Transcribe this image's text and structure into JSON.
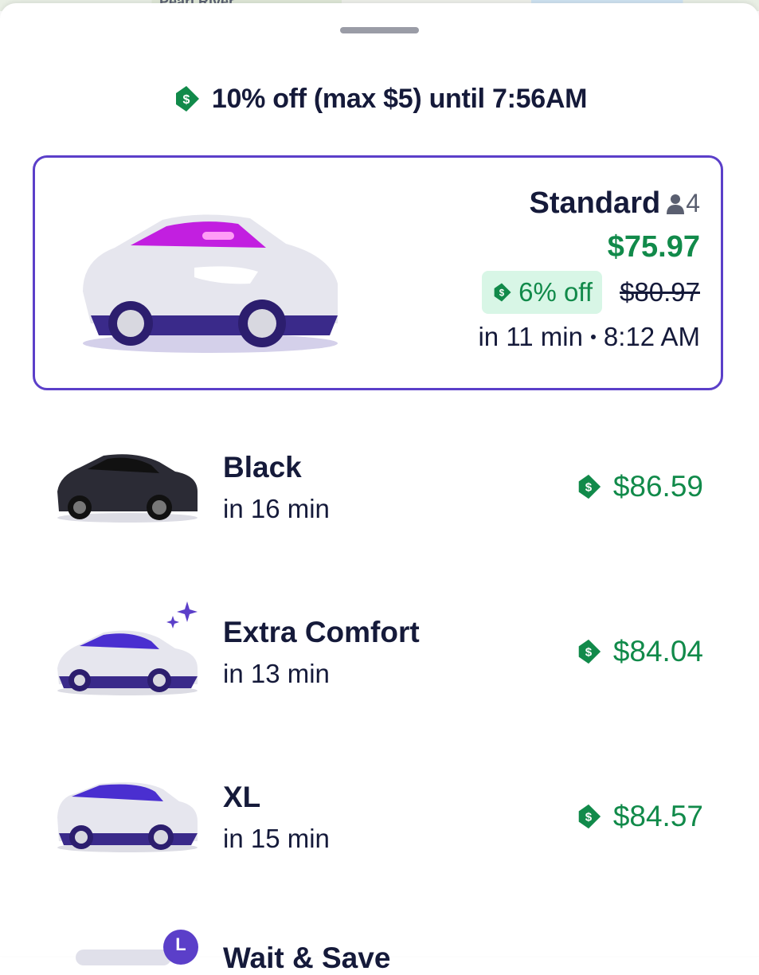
{
  "map": {
    "label": "Pearl River"
  },
  "promo": {
    "text": "10% off (max $5) until 7:56AM",
    "icon": "discount-tag-icon"
  },
  "colors": {
    "accent": "#5b3fc9",
    "price_green": "#118a4a",
    "badge_bg": "#d8f6e6",
    "text": "#151a3a"
  },
  "standard": {
    "title": "Standard",
    "seats": "4",
    "price": "$75.97",
    "discount": "6% off",
    "original_price": "$80.97",
    "eta": "in 11 min",
    "arrival": "8:12 AM"
  },
  "options": [
    {
      "title": "Black",
      "eta": "in 16 min",
      "price": "$86.59"
    },
    {
      "title": "Extra Comfort",
      "eta": "in 13 min",
      "price": "$84.04"
    },
    {
      "title": "XL",
      "eta": "in 15 min",
      "price": "$84.57"
    }
  ],
  "wait_save": {
    "title": "Wait & Save",
    "icon_letter": "L"
  }
}
